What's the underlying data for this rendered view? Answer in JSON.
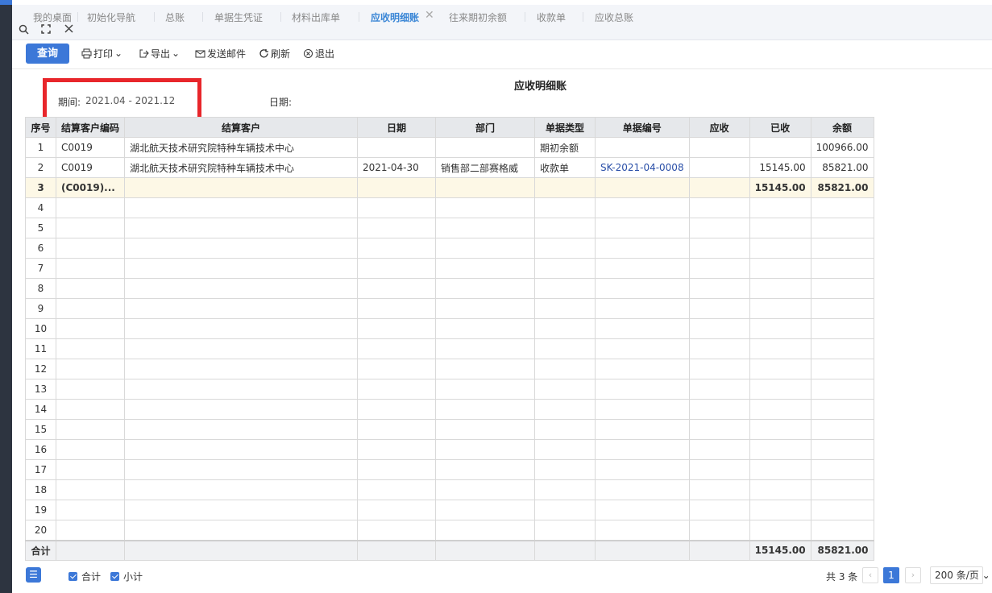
{
  "tabs": [
    {
      "label": "我的桌面",
      "active": false
    },
    {
      "label": "初始化导航",
      "active": false
    },
    {
      "label": "总账",
      "active": false
    },
    {
      "label": "单据生凭证",
      "active": false
    },
    {
      "label": "材料出库单",
      "active": false
    },
    {
      "label": "应收明细账",
      "active": true
    },
    {
      "label": "往来期初余额",
      "active": false
    },
    {
      "label": "收款单",
      "active": false
    },
    {
      "label": "应收总账",
      "active": false
    }
  ],
  "toolbar": {
    "query": "查询",
    "print": "打印",
    "export": "导出",
    "send_email": "发送邮件",
    "refresh": "刷新",
    "exit": "退出"
  },
  "report": {
    "title": "应收明细账",
    "period_label": "期间:",
    "period_value": "2021.04 - 2021.12",
    "date_label": "日期:"
  },
  "table": {
    "headers": [
      "序号",
      "结算客户编码",
      "结算客户",
      "日期",
      "部门",
      "单据类型",
      "单据编号",
      "应收",
      "已收",
      "余额"
    ],
    "rows": [
      [
        "1",
        "C0019",
        "湖北航天技术研究院特种车辆技术中心",
        "",
        "",
        "期初余额",
        "",
        "",
        "",
        "100966.00"
      ],
      [
        "2",
        "C0019",
        "湖北航天技术研究院特种车辆技术中心",
        "2021-04-30",
        "销售部二部赛格威",
        "收款单",
        "SK-2021-04-0008",
        "",
        "15145.00",
        "85821.00"
      ],
      [
        "3",
        "(C0019)...",
        "",
        "",
        "",
        "",
        "",
        "",
        "15145.00",
        "85821.00"
      ],
      [
        "4",
        "",
        "",
        "",
        "",
        "",
        "",
        "",
        "",
        ""
      ],
      [
        "5",
        "",
        "",
        "",
        "",
        "",
        "",
        "",
        "",
        ""
      ],
      [
        "6",
        "",
        "",
        "",
        "",
        "",
        "",
        "",
        "",
        ""
      ],
      [
        "7",
        "",
        "",
        "",
        "",
        "",
        "",
        "",
        "",
        ""
      ],
      [
        "8",
        "",
        "",
        "",
        "",
        "",
        "",
        "",
        "",
        ""
      ],
      [
        "9",
        "",
        "",
        "",
        "",
        "",
        "",
        "",
        "",
        ""
      ],
      [
        "10",
        "",
        "",
        "",
        "",
        "",
        "",
        "",
        "",
        ""
      ],
      [
        "11",
        "",
        "",
        "",
        "",
        "",
        "",
        "",
        "",
        ""
      ],
      [
        "12",
        "",
        "",
        "",
        "",
        "",
        "",
        "",
        "",
        ""
      ],
      [
        "13",
        "",
        "",
        "",
        "",
        "",
        "",
        "",
        "",
        ""
      ],
      [
        "14",
        "",
        "",
        "",
        "",
        "",
        "",
        "",
        "",
        ""
      ],
      [
        "15",
        "",
        "",
        "",
        "",
        "",
        "",
        "",
        "",
        ""
      ],
      [
        "16",
        "",
        "",
        "",
        "",
        "",
        "",
        "",
        "",
        ""
      ],
      [
        "17",
        "",
        "",
        "",
        "",
        "",
        "",
        "",
        "",
        ""
      ],
      [
        "18",
        "",
        "",
        "",
        "",
        "",
        "",
        "",
        "",
        ""
      ],
      [
        "19",
        "",
        "",
        "",
        "",
        "",
        "",
        "",
        "",
        ""
      ],
      [
        "20",
        "",
        "",
        "",
        "",
        "",
        "",
        "",
        "",
        ""
      ]
    ],
    "total": [
      "合计",
      "",
      "",
      "",
      "",
      "",
      "",
      "",
      "15145.00",
      "85821.00"
    ]
  },
  "footer": {
    "total_label": "合计",
    "subtotal_label": "小计",
    "count_text": "共 3 条",
    "current_page": "1",
    "page_size": "200 条/页"
  },
  "colors": {
    "accent": "#3c78d8",
    "highlight_box": "#e8262b",
    "subtotal_row": "#fdf8e6"
  }
}
